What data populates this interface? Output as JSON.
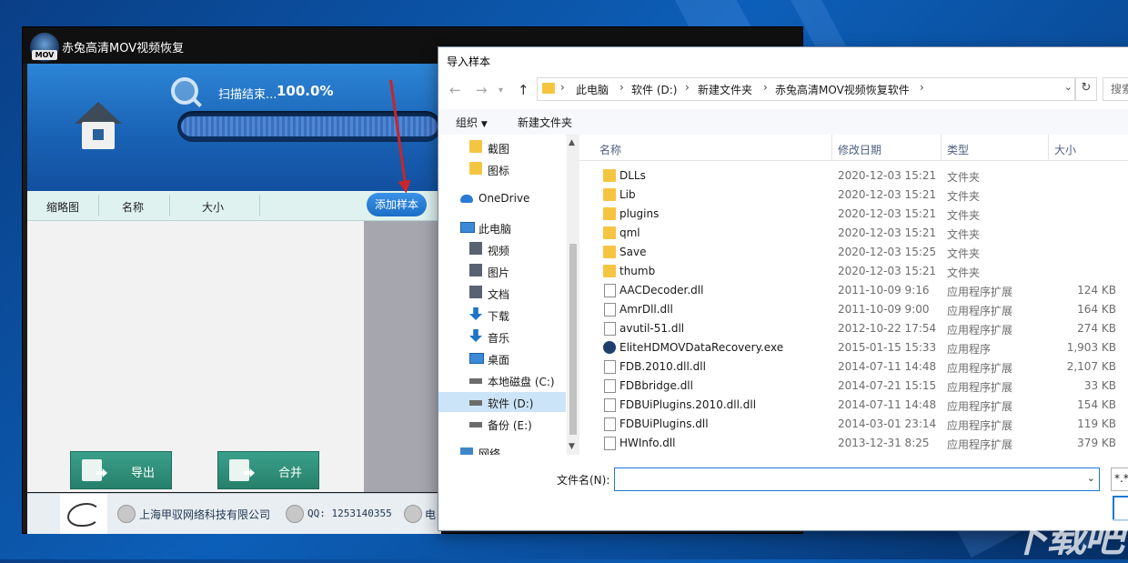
{
  "app": {
    "title": "赤兔高清MOV视频恢复",
    "logo_text": "MOV",
    "scan_label": "扫描结束...",
    "scan_percent": "100.0%",
    "progress_fraction": 1.0,
    "columns": [
      "缩略图",
      "名称",
      "大小"
    ],
    "add_sample_button": "添加样本",
    "export_button": "导出",
    "merge_button": "合并",
    "footer": {
      "company": "上海甲驭网络科技有限公司",
      "qq": "QQ: 1253140355",
      "tel": "电"
    }
  },
  "dialog": {
    "title": "导入样本",
    "breadcrumbs": [
      "此电脑",
      "软件 (D:)",
      "新建文件夹",
      "赤兔高清MOV视频恢复软件"
    ],
    "search_placeholder": "搜索",
    "toolbar": {
      "organize": "组织",
      "new_folder": "新建文件夹"
    },
    "tree": [
      {
        "label": "截图",
        "icon": "folder-icon"
      },
      {
        "label": "图标",
        "icon": "folder-icon"
      },
      {
        "label": "OneDrive",
        "icon": "cloud-icon"
      },
      {
        "label": "此电脑",
        "icon": "computer-icon"
      },
      {
        "label": "视频",
        "icon": "video-icon"
      },
      {
        "label": "图片",
        "icon": "picture-icon"
      },
      {
        "label": "文档",
        "icon": "document-icon"
      },
      {
        "label": "下载",
        "icon": "download-icon"
      },
      {
        "label": "音乐",
        "icon": "music-icon"
      },
      {
        "label": "桌面",
        "icon": "desktop-icon"
      },
      {
        "label": "本地磁盘 (C:)",
        "icon": "drive-icon"
      },
      {
        "label": "软件 (D:)",
        "icon": "drive-icon",
        "selected": true
      },
      {
        "label": "备份 (E:)",
        "icon": "drive-icon"
      },
      {
        "label": "网络",
        "icon": "network-icon"
      }
    ],
    "file_columns": {
      "name": "名称",
      "date": "修改日期",
      "type": "类型",
      "size": "大小"
    },
    "files": [
      {
        "name": "DLLs",
        "date": "2020-12-03 15:21",
        "type": "文件夹",
        "size": "",
        "kind": "folder"
      },
      {
        "name": "Lib",
        "date": "2020-12-03 15:21",
        "type": "文件夹",
        "size": "",
        "kind": "folder"
      },
      {
        "name": "plugins",
        "date": "2020-12-03 15:21",
        "type": "文件夹",
        "size": "",
        "kind": "folder"
      },
      {
        "name": "qml",
        "date": "2020-12-03 15:21",
        "type": "文件夹",
        "size": "",
        "kind": "folder"
      },
      {
        "name": "Save",
        "date": "2020-12-03 15:25",
        "type": "文件夹",
        "size": "",
        "kind": "folder"
      },
      {
        "name": "thumb",
        "date": "2020-12-03 15:21",
        "type": "文件夹",
        "size": "",
        "kind": "folder"
      },
      {
        "name": "AACDecoder.dll",
        "date": "2011-10-09 9:16",
        "type": "应用程序扩展",
        "size": "124 KB",
        "kind": "dll"
      },
      {
        "name": "AmrDll.dll",
        "date": "2011-10-09 9:00",
        "type": "应用程序扩展",
        "size": "164 KB",
        "kind": "dll"
      },
      {
        "name": "avutil-51.dll",
        "date": "2012-10-22 17:54",
        "type": "应用程序扩展",
        "size": "274 KB",
        "kind": "dll"
      },
      {
        "name": "EliteHDMOVDataRecovery.exe",
        "date": "2015-01-15 15:33",
        "type": "应用程序",
        "size": "1,903 KB",
        "kind": "exe"
      },
      {
        "name": "FDB.2010.dll.dll",
        "date": "2014-07-11 14:48",
        "type": "应用程序扩展",
        "size": "2,107 KB",
        "kind": "dll"
      },
      {
        "name": "FDBbridge.dll",
        "date": "2014-07-21 15:15",
        "type": "应用程序扩展",
        "size": "33 KB",
        "kind": "dll"
      },
      {
        "name": "FDBUiPlugins.2010.dll.dll",
        "date": "2014-07-11 14:48",
        "type": "应用程序扩展",
        "size": "154 KB",
        "kind": "dll"
      },
      {
        "name": "FDBUiPlugins.dll",
        "date": "2014-03-01 23:14",
        "type": "应用程序扩展",
        "size": "119 KB",
        "kind": "dll"
      },
      {
        "name": "HWInfo.dll",
        "date": "2013-12-31 8:25",
        "type": "应用程序扩展",
        "size": "379 KB",
        "kind": "dll"
      }
    ],
    "filename_label": "文件名(N):",
    "filename_value": "",
    "filter_text": "*.*"
  },
  "watermark": "下载吧"
}
